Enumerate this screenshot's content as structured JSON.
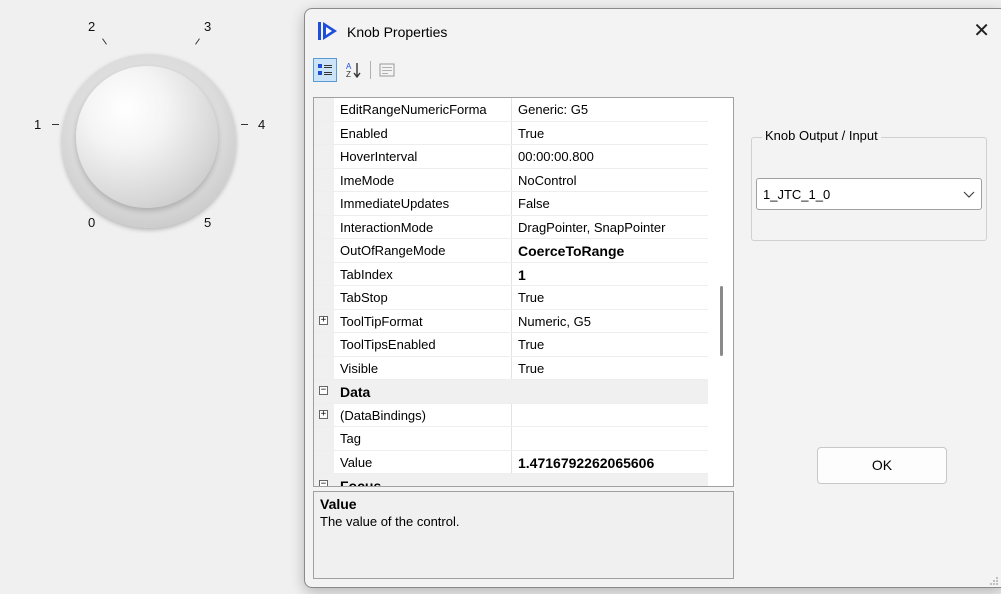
{
  "knob": {
    "scale_labels": [
      "0",
      "1",
      "2",
      "3",
      "4",
      "5"
    ]
  },
  "dialog": {
    "title": "Knob Properties",
    "close_glyph": "✕",
    "icon": "app-logo-icon"
  },
  "toolbar": {
    "buttons": [
      "categorized-icon",
      "alphabetical-icon",
      "property-pages-icon"
    ]
  },
  "property_grid": {
    "rows": [
      {
        "name": "EditRangeNumericForma",
        "value": "Generic: G5"
      },
      {
        "name": "Enabled",
        "value": "True"
      },
      {
        "name": "HoverInterval",
        "value": "00:00:00.800"
      },
      {
        "name": "ImeMode",
        "value": "NoControl"
      },
      {
        "name": "ImmediateUpdates",
        "value": "False"
      },
      {
        "name": "InteractionMode",
        "value": "DragPointer, SnapPointer"
      },
      {
        "name": "OutOfRangeMode",
        "value": "CoerceToRange"
      },
      {
        "name": "TabIndex",
        "value": "1"
      },
      {
        "name": "TabStop",
        "value": "True"
      },
      {
        "name": "ToolTipFormat",
        "value": "Numeric, G5",
        "expander": "+"
      },
      {
        "name": "ToolTipsEnabled",
        "value": "True"
      },
      {
        "name": "Visible",
        "value": "True"
      },
      {
        "name": "Data",
        "value": "",
        "expander": "−"
      },
      {
        "name": "(DataBindings)",
        "value": "",
        "expander": "+"
      },
      {
        "name": "Tag",
        "value": ""
      },
      {
        "name": "Value",
        "value": "1.4716792262065606"
      },
      {
        "name": "Focus",
        "value": "",
        "expander": "−"
      }
    ]
  },
  "description": {
    "title": "Value",
    "text": "The value of the control."
  },
  "output_group": {
    "label": "Knob Output / Input",
    "selected": "1_JTC_1_0"
  },
  "ok_label": "OK",
  "colors": {
    "toolbar_selected": "#cce4f7",
    "app_icon": "#1f4fd8"
  }
}
